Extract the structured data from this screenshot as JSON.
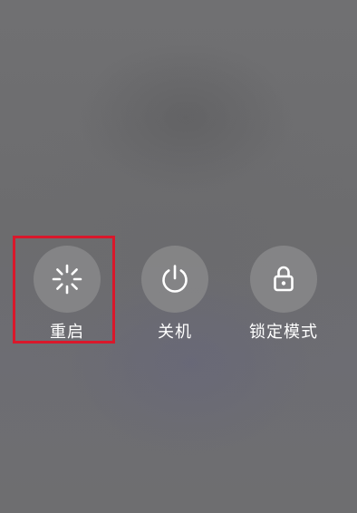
{
  "power_menu": {
    "options": [
      {
        "id": "restart",
        "label": "重启",
        "icon": "restart-spinner-icon"
      },
      {
        "id": "poweroff",
        "label": "关机",
        "icon": "power-icon"
      },
      {
        "id": "lockdown",
        "label": "锁定模式",
        "icon": "lock-icon"
      }
    ],
    "highlighted_option": "restart"
  },
  "colors": {
    "background": "#6e6e70",
    "button_circle": "#8c8c8e",
    "icon": "#ffffff",
    "label": "#ffffff",
    "highlight_border": "#d9182b"
  }
}
